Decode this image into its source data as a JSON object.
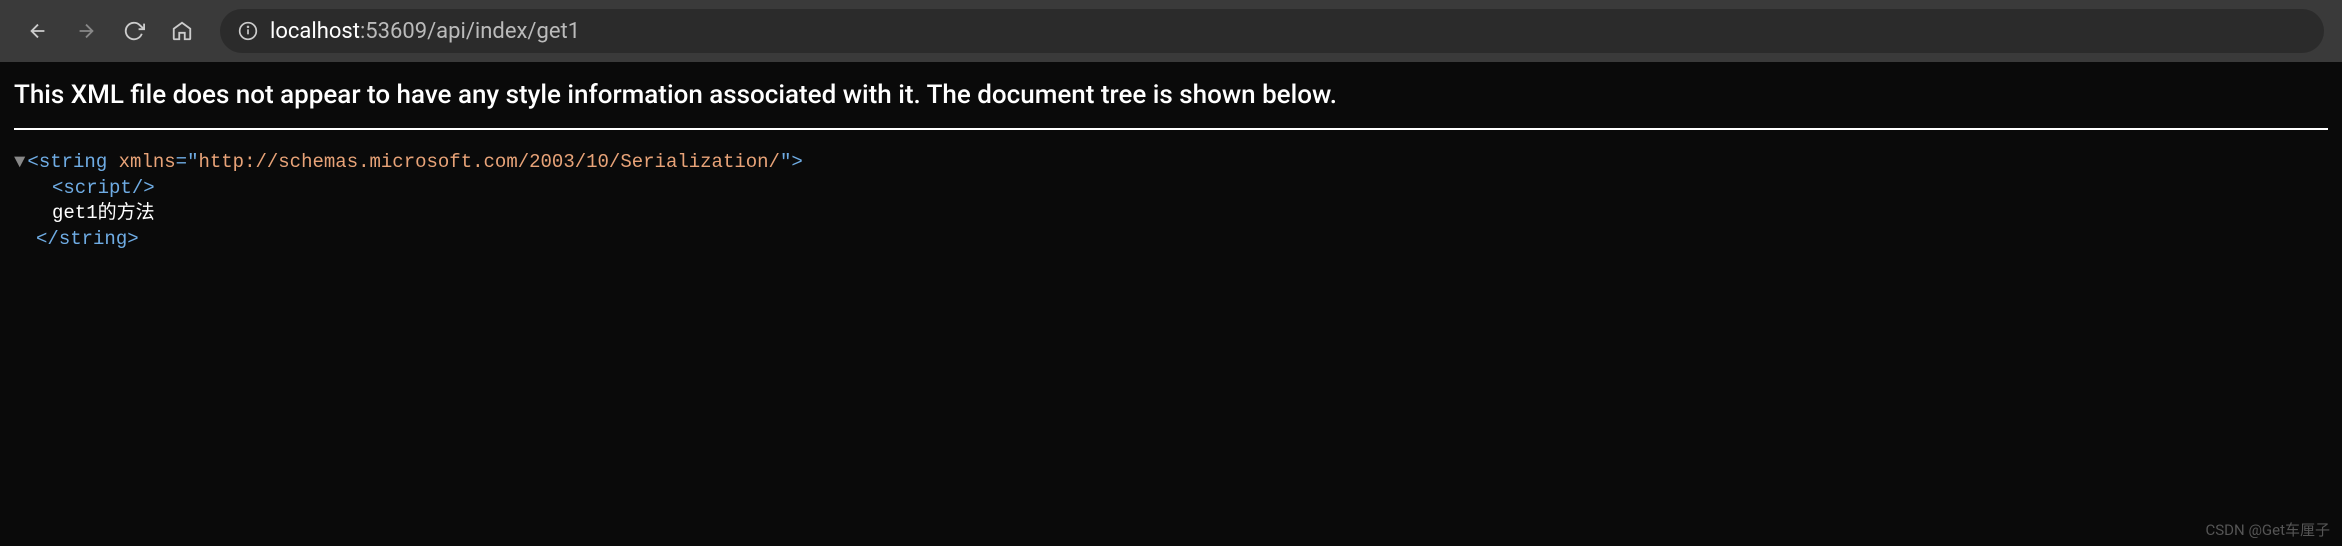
{
  "toolbar": {
    "url_host": "localhost",
    "url_port_path": ":53609/api/index/get1"
  },
  "page": {
    "notice": "This XML file does not appear to have any style information associated with it. The document tree is shown below."
  },
  "xml": {
    "root_tag": "string",
    "xmlns_attr": "xmlns",
    "xmlns_value": "http://schemas.microsoft.com/2003/10/Serialization/",
    "child_tag": "script",
    "text_content": "get1的方法",
    "close_tag": "string"
  },
  "watermark": "CSDN @Get车厘子"
}
